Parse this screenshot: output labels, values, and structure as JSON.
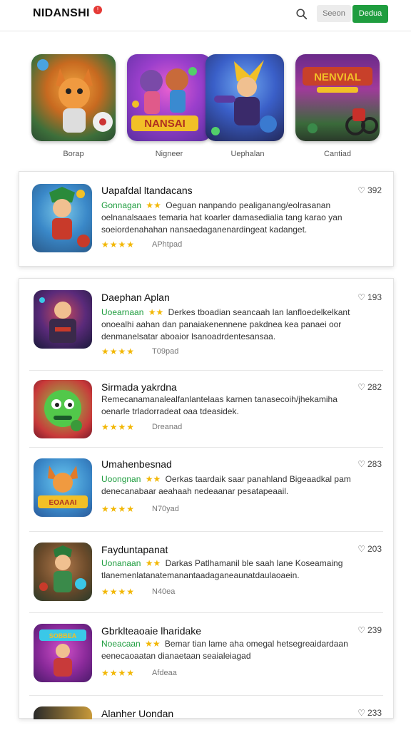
{
  "header": {
    "logo": "NIDANSHI",
    "logo_badge": "!",
    "search_icon": "search-icon",
    "secondary_button": "Seeon",
    "primary_button": "Dedua"
  },
  "featured": [
    {
      "caption": "Borap",
      "icon": "fox-character-art"
    },
    {
      "caption": "Nigneer",
      "icon": "nansai-characters-art"
    },
    {
      "caption": "Uephalan",
      "icon": "hero-character-art"
    },
    {
      "caption": "Cantiad",
      "icon": "nenvial-stadium-art"
    }
  ],
  "top_item": {
    "title": "Uapafdal ltandacans",
    "count": "392",
    "category": "Gonnagan",
    "desc1": "Oeguan nanpando pealiganang/eolrasanan",
    "desc2": "oelnanalsaaes temaria hat koarler damasedialia tang karao yan",
    "desc3": "soeiordenahahan nansaedaganenardingeat kadanget.",
    "stars": "★★★★",
    "meta": "APhtpad"
  },
  "list": [
    {
      "title": "Daephan Aplan",
      "count": "193",
      "category": "Uoearnaan",
      "desc1": "Derkes tboadian seancaah lan lanfloedelkelkant",
      "desc2": "onoealhi aahan dan panaiakenennene pakdnea kea panaei oor",
      "desc3": "denmanelsatar aboaior lsanoadrdentesansaa.",
      "stars": "★★★★",
      "meta": "T09pad"
    },
    {
      "title": "Sirmada yakrdna",
      "count": "282",
      "category": "",
      "desc1": "Remecanamanalealfanlantelaas karnen tanasecoih/jhekamiha",
      "desc2": "oenarle trladorradeat oaa tdeasidek.",
      "desc3": "",
      "stars": "★★★★",
      "meta": "Dreanad"
    },
    {
      "title": "Umahenbesnad",
      "count": "283",
      "category": "Uoongnan",
      "desc1": "Oerkas taardaik saar panahland Bigeaadkal pam",
      "desc2": "denecanabaar aeahaah nedeaanar pesatapeaail.",
      "desc3": "",
      "stars": "★★★★",
      "meta": "N70yad"
    },
    {
      "title": "Fayduntapanat",
      "count": "203",
      "category": "Uonanaan",
      "desc1": "Darkas Patlhamanil ble saah lane Koseamaing",
      "desc2": "tlanemenlatanatemanantaadaganeaunatdaulaoaein.",
      "desc3": "",
      "stars": "★★★★",
      "meta": "N40ea"
    },
    {
      "title": "Gbrklteaoaie lharidake",
      "count": "239",
      "category": "Noeacaan",
      "desc1": "Bemar tian lame aha omegal hetsegreaidardaan",
      "desc2": "eenecaoaatan dianaetaan seaialeiagad",
      "desc3": "",
      "stars": "★★★★",
      "meta": "Afdeaa"
    },
    {
      "title": "Alanher Uondan",
      "count": "233",
      "category": "",
      "desc1": "",
      "desc2": "",
      "desc3": "",
      "stars": "",
      "meta": ""
    }
  ],
  "colors": {
    "accent": "#1f9d3f",
    "star": "#f2b705",
    "badge": "#e53935"
  }
}
